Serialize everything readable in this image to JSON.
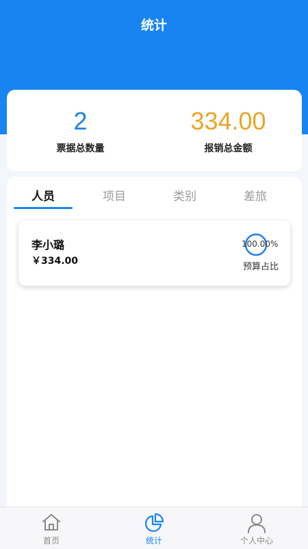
{
  "header": {
    "title": "统计"
  },
  "summary": {
    "ticket_count": "2",
    "ticket_count_label": "票据总数量",
    "total_amount": "334.00",
    "total_amount_label": "报销总金额"
  },
  "tabs": [
    {
      "label": "人员",
      "active": true
    },
    {
      "label": "项目",
      "active": false
    },
    {
      "label": "类别",
      "active": false
    },
    {
      "label": "差旅",
      "active": false
    }
  ],
  "people": [
    {
      "name": "李小璐",
      "amount": "￥334.00",
      "ratio": "100.00%",
      "ratio_label": "预算占比",
      "ratio_fraction": 1.0
    }
  ],
  "tabbar": [
    {
      "label": "首页",
      "icon": "home-icon",
      "active": false
    },
    {
      "label": "统计",
      "icon": "pie-chart-icon",
      "active": true
    },
    {
      "label": "个人中心",
      "icon": "user-icon",
      "active": false
    }
  ],
  "colors": {
    "primary": "#1784f2",
    "amount": "#eaa527",
    "count": "#1f80e8"
  }
}
